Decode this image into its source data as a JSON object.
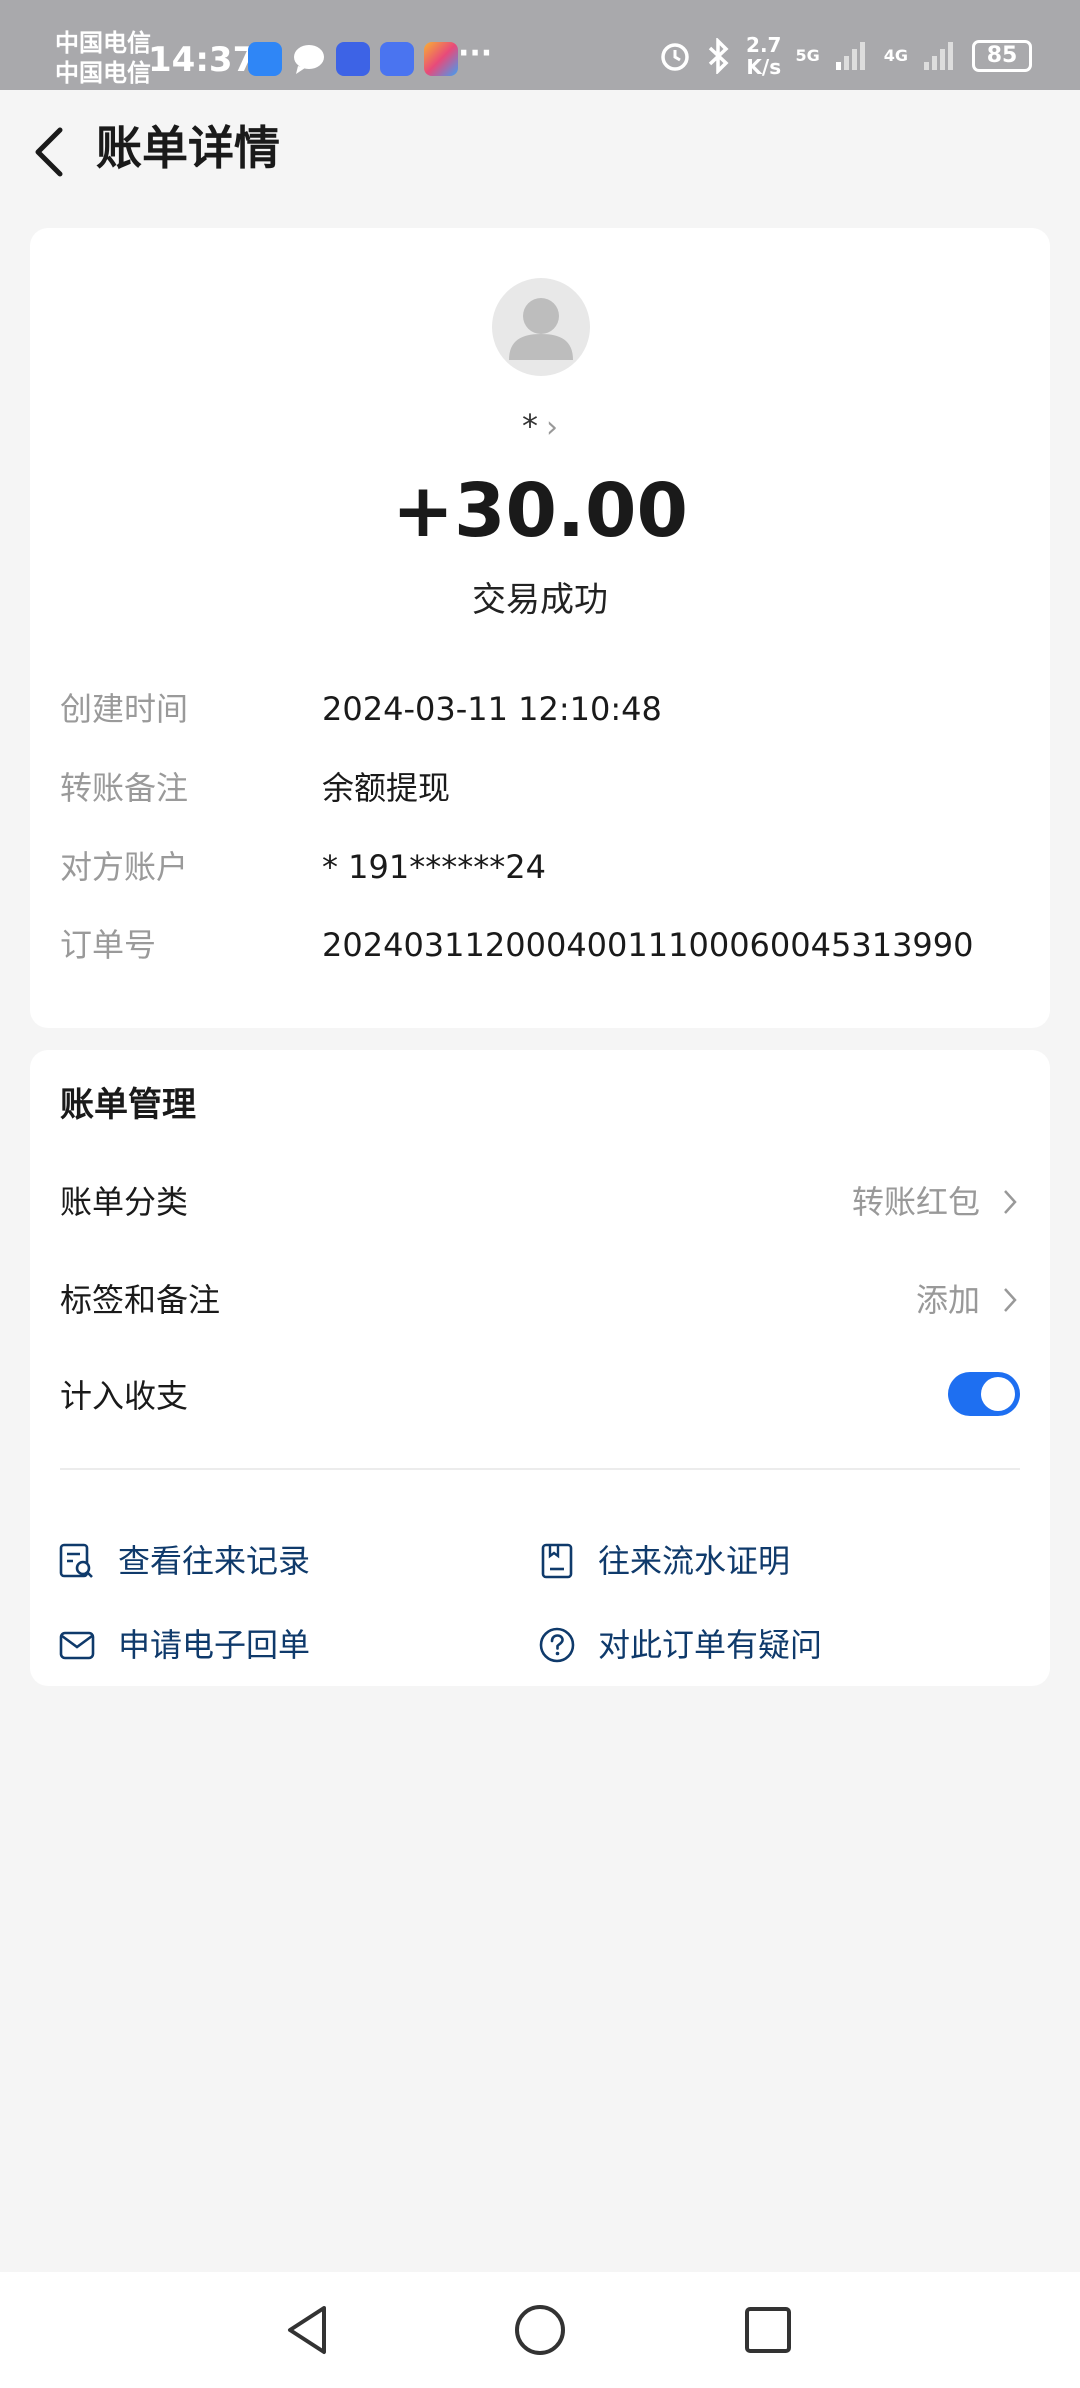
{
  "status_bar": {
    "carrier_1": "中国电信",
    "carrier_2": "中国电信",
    "time": "14:37",
    "more": "···",
    "net_speed_value": "2.7",
    "net_speed_unit": "K/s",
    "signal_1": "5G",
    "signal_2": "4G",
    "battery": "85"
  },
  "header": {
    "title": "账单详情"
  },
  "transaction": {
    "payee": "*",
    "amount": "+30.00",
    "status": "交易成功",
    "details": [
      {
        "label": "创建时间",
        "value": "2024-03-11 12:10:48"
      },
      {
        "label": "转账备注",
        "value": "余额提现"
      },
      {
        "label": "对方账户",
        "value": "* 191******24"
      },
      {
        "label": "订单号",
        "value": "2024031120004001110006004531 3990"
      }
    ]
  },
  "management": {
    "title": "账单管理",
    "category_label": "账单分类",
    "category_value": "转账红包",
    "tags_label": "标签和备注",
    "tags_value": "添加",
    "include_label": "计入收支",
    "include_on": true,
    "actions": {
      "records": "查看往来记录",
      "statement": "往来流水证明",
      "receipt": "申请电子回单",
      "question": "对此订单有疑问"
    }
  },
  "colors": {
    "accent": "#1e6ff1",
    "action_text": "#0f3a6b",
    "status_bar_bg": "#a9a9ac"
  }
}
